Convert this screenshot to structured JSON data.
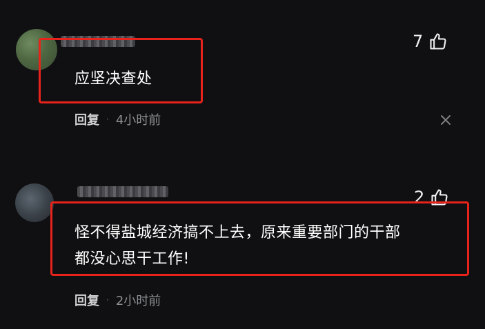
{
  "comments": [
    {
      "text": "应坚决查处",
      "like_count": "7",
      "reply_label": "回复",
      "separator": "·",
      "time": "4小时前",
      "icons": {
        "like": "thumbs-up-icon",
        "close": "close-icon"
      }
    },
    {
      "text_line1": "怪不得盐城经济搞不上去，原来重要部门的干部",
      "text_line2": "都没心思干工作!",
      "like_count": "2",
      "reply_label": "回复",
      "separator": "·",
      "time": "2小时前",
      "icons": {
        "like": "thumbs-up-icon"
      }
    }
  ],
  "colors": {
    "background": "#101012",
    "highlight": "#e8231b",
    "text": "#ffffff",
    "muted": "#8d8e93"
  }
}
